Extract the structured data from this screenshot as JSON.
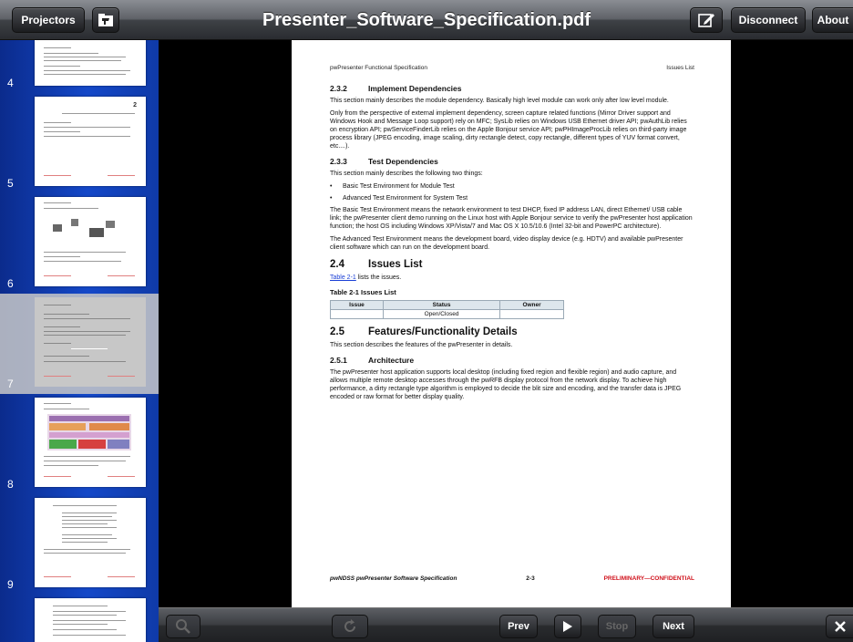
{
  "toolbar": {
    "projectors_label": "Projectors",
    "title": "Presenter_Software_Specification.pdf",
    "disconnect_label": "Disconnect",
    "about_label": "About"
  },
  "thumbnails": [
    {
      "number": "4"
    },
    {
      "number": "5"
    },
    {
      "number": "6"
    },
    {
      "number": "7",
      "selected": true
    },
    {
      "number": "8"
    },
    {
      "number": "9"
    }
  ],
  "document": {
    "header_left": "pwPresenter Functional Specification",
    "header_right": "Issues List",
    "s232_num": "2.3.2",
    "s232_title": "Implement Dependencies",
    "s232_p1": "This section mainly describes the module dependency. Basically high level module can work only after low level module.",
    "s232_p2": "Only from the perspective of external implement dependency, screen capture related functions (Mirror Driver support and Windows Hook and Message Loop support) rely on MFC; SysLib relies on Windows USB Ethernet driver API; pwAuthLib relies on encryption API; pwServiceFinderLib relies on the Apple Bonjour service API; pwPHImageProcLib relies on third-party image process library (JPEG encoding, image scaling, dirty rectangle detect, copy rectangle, different types of YUV format convert, etc....).",
    "s233_num": "2.3.3",
    "s233_title": "Test Dependencies",
    "s233_intro": "This section mainly describes the following two things:",
    "bullet1": "Basic Test Environment for Module Test",
    "bullet2": "Advanced Test Environment for System Test",
    "s233_p1": "The Basic Test Environment means the network environment to test DHCP, fixed IP address LAN, direct Ethernet/ USB cable link; the pwPresenter client demo running on the Linux host with Apple Bonjour service to verify the pwPresenter host application function; the host OS including Windows XP/Vista/7 and Mac OS X 10.5/10.6 (Intel 32-bit and PowerPC architecture).",
    "s233_p2": "The Advanced Test Environment means the development board, video display device (e.g. HDTV) and available pwPresenter client software which can run on the development board.",
    "s24_num": "2.4",
    "s24_title": "Issues List",
    "s24_link": "Table 2-1",
    "s24_text": " lists the issues.",
    "table_caption": "Table 2-1  Issues List",
    "table_headers": [
      "Issue",
      "Status",
      "Owner"
    ],
    "table_row": [
      "",
      "Open/Closed",
      ""
    ],
    "s25_num": "2.5",
    "s25_title": "Features/Functionality Details",
    "s25_text": "This section describes the features of the pwPresenter in details.",
    "s251_num": "2.5.1",
    "s251_title": "Architecture",
    "s251_p": "The pwPresenter host application supports local desktop (including fixed region and flexible region) and audio capture, and allows multiple remote desktop accesses through the pwRFB display protocol from the network display. To achieve high performance, a dirty rectangle type algorithm is employed to decide the blit size and encoding, and the transfer data is JPEG encoded or raw format for better display quality.",
    "footer_left": "pwNDSS pwPresenter Software Specification",
    "footer_center": "2-3",
    "footer_right": "PRELIMINARY—CONFIDENTIAL"
  },
  "bottombar": {
    "prev_label": "Prev",
    "stop_label": "Stop",
    "next_label": "Next"
  },
  "icons": {
    "folder": "folder-icon",
    "edit": "edit-icon",
    "search": "search-icon",
    "refresh": "refresh-icon",
    "play": "play-icon",
    "close": "close-icon"
  },
  "colors": {
    "sidebar_blue": "#1448c8",
    "link_blue": "#1a3fd6",
    "confidential_red": "#d0101a"
  }
}
